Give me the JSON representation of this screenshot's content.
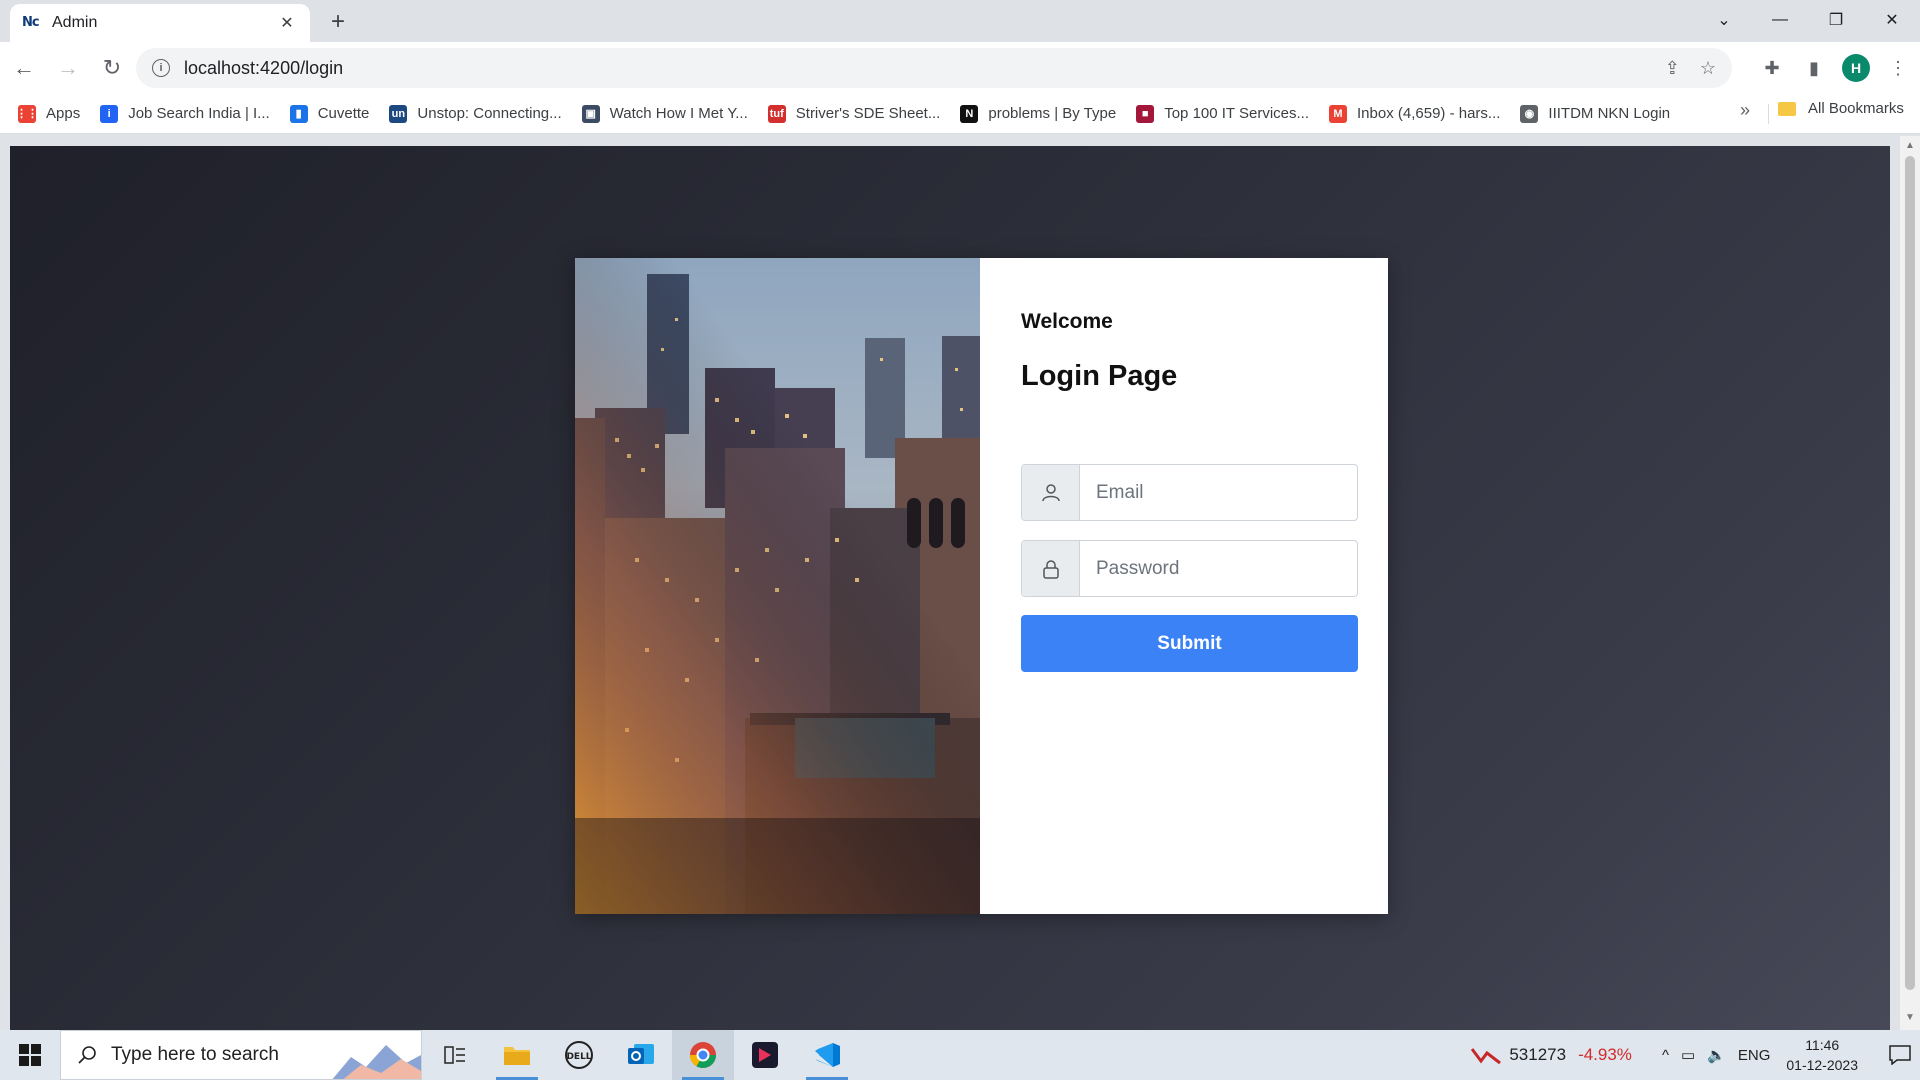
{
  "browser": {
    "tab_title": "Admin",
    "tab_favicon_text": "Nc",
    "url": "localhost:4200/login",
    "profile_initial": "H"
  },
  "bookmarks": [
    {
      "label": "Apps",
      "icon": "apps-grid-icon",
      "color": "#ea4335"
    },
    {
      "label": "Job Search India | I...",
      "icon": "indeed-icon",
      "color": "#2164f3"
    },
    {
      "label": "Cuvette",
      "icon": "cuvette-icon",
      "color": "#1a73e8"
    },
    {
      "label": "Unstop: Connecting...",
      "icon": "unstop-icon",
      "color": "#1c4980"
    },
    {
      "label": "Watch How I Met Y...",
      "icon": "movie-icon",
      "color": "#3c4b64"
    },
    {
      "label": "Striver's SDE Sheet...",
      "icon": "tuf-icon",
      "color": "#d32f2f"
    },
    {
      "label": "problems | By Type",
      "icon": "notion-icon",
      "color": "#111111"
    },
    {
      "label": "Top 100 IT Services...",
      "icon": "square-icon",
      "color": "#a3173b"
    },
    {
      "label": "Inbox (4,659) - hars...",
      "icon": "gmail-icon",
      "color": "#ea4335"
    },
    {
      "label": "IIITDM NKN Login",
      "icon": "globe-icon",
      "color": "#5f6368"
    }
  ],
  "all_bookmarks_label": "All Bookmarks",
  "login": {
    "welcome": "Welcome",
    "title": "Login Page",
    "email_placeholder": "Email",
    "password_placeholder": "Password",
    "submit_label": "Submit"
  },
  "taskbar": {
    "search_placeholder": "Type here to search",
    "stock_value": "531273",
    "stock_change": "-4.93%",
    "language": "ENG",
    "time": "11:46",
    "date": "01-12-2023"
  },
  "colors": {
    "accent": "#3b82f6",
    "page_bg": "#2b2d38"
  }
}
